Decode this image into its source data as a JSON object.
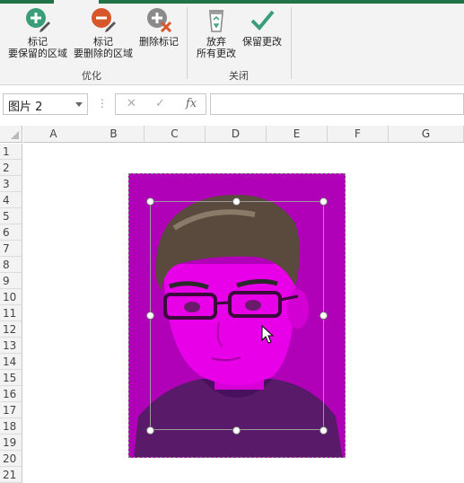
{
  "ribbon": {
    "optimize": {
      "group_label": "优化",
      "mark_keep": {
        "line1": "标记",
        "line2": "要保留的区域"
      },
      "mark_delete": {
        "line1": "标记",
        "line2": "要删除的区域"
      },
      "delete_mark": {
        "label": "删除标记"
      }
    },
    "close": {
      "group_label": "关闭",
      "discard": {
        "line1": "放弃",
        "line2": "所有更改"
      },
      "keep": {
        "label": "保留更改"
      }
    }
  },
  "formula_bar": {
    "name_box": "图片 2",
    "separator_dots": "⋮",
    "cancel_glyph": "✕",
    "enter_glyph": "✓",
    "fx_glyph": "fx",
    "formula_value": ""
  },
  "sheet": {
    "columns": [
      "A",
      "B",
      "C",
      "D",
      "E",
      "F",
      "G"
    ],
    "rows": [
      "1",
      "2",
      "3",
      "4",
      "5",
      "6",
      "7",
      "8",
      "9",
      "10",
      "11",
      "12",
      "13",
      "14",
      "15",
      "16",
      "17",
      "18",
      "19",
      "20",
      "21"
    ]
  },
  "picture": {
    "fill_color": "#b000b8",
    "subject": "cartoon portrait of man with glasses"
  }
}
